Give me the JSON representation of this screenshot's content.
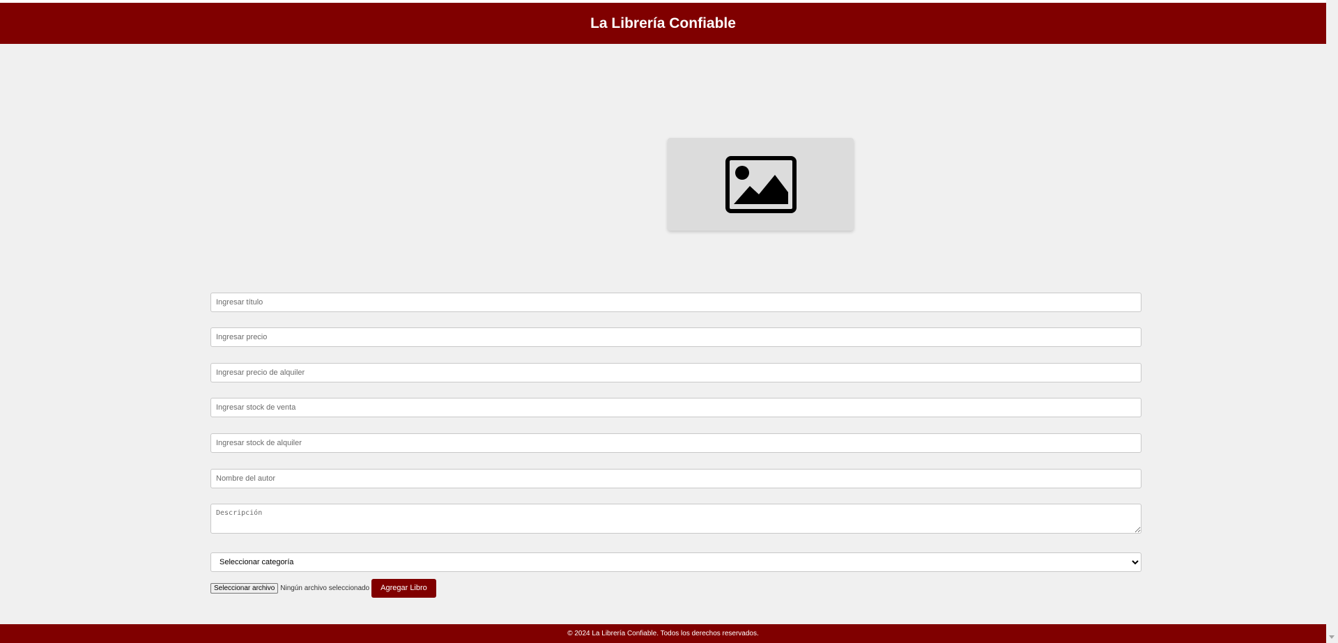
{
  "header": {
    "title": "La Librería Confiable"
  },
  "image_preview": {
    "icon": "image-placeholder-icon"
  },
  "form": {
    "title_placeholder": "Ingresar título",
    "price_placeholder": "Ingresar precio",
    "rental_price_placeholder": "Ingresar precio de alquiler",
    "sale_stock_placeholder": "Ingresar stock de venta",
    "rental_stock_placeholder": "Ingresar stock de alquiler",
    "author_placeholder": "Nombre del autor",
    "description_placeholder": "Descripción",
    "category_selected": "Seleccionar categoría",
    "file_button_label": "Seleccionar archivo",
    "file_status": "Ningún archivo seleccionado",
    "submit_label": "Agregar Libro"
  },
  "footer": {
    "text": "© 2024 La Librería Confiable. Todos los derechos reservados."
  },
  "colors": {
    "brand": "#800000",
    "background": "#f0f0f0",
    "preview_bg": "#dcdcdc"
  }
}
